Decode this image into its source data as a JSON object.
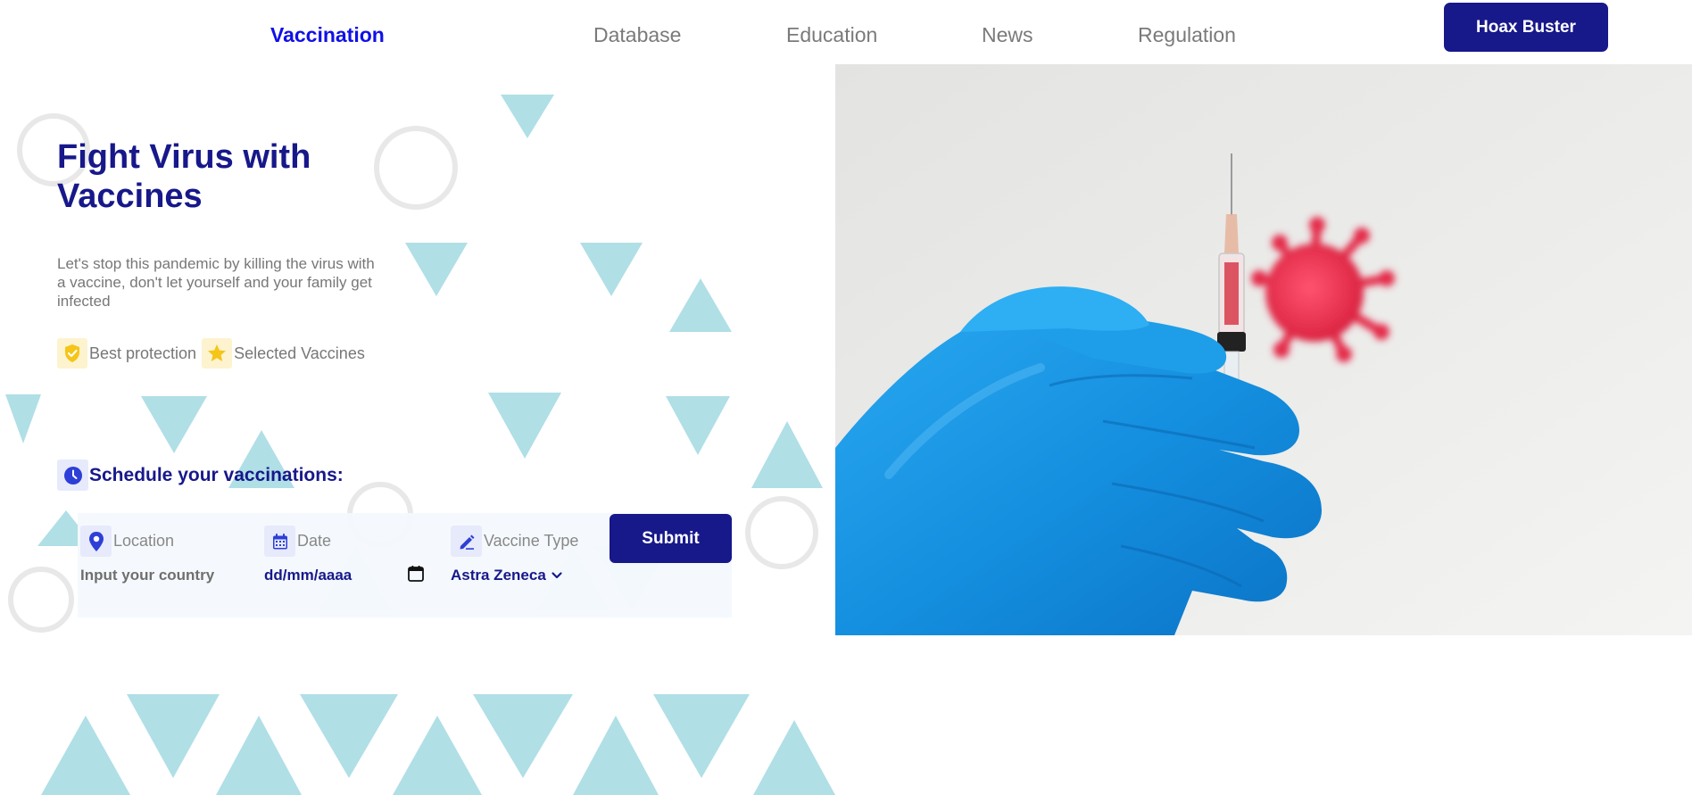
{
  "nav": {
    "brand": "Vaccination",
    "links": [
      "Database",
      "Education",
      "News",
      "Regulation"
    ],
    "cta": "Hoax Buster"
  },
  "hero": {
    "title": "Fight Virus with Vaccines",
    "description": "Let's stop this pandemic by killing the virus with a vaccine, don't let yourself and your family get infected",
    "features": [
      {
        "icon": "shield-check-icon",
        "label": "Best protection"
      },
      {
        "icon": "star-icon",
        "label": "Selected Vaccines"
      }
    ]
  },
  "schedule": {
    "icon": "clock-icon",
    "title": "Schedule your vaccinations:",
    "location": {
      "label": "Location",
      "placeholder": "Input your country",
      "icon": "location-pin-icon"
    },
    "date": {
      "label": "Date",
      "value": "dd/mm/aaaa",
      "icon": "calendar-icon"
    },
    "vaccine": {
      "label": "Vaccine Type",
      "selected": "Astra Zeneca",
      "icon": "pen-icon"
    },
    "submit": "Submit"
  },
  "colors": {
    "primary": "#17188a",
    "brand_link": "#1010e8",
    "muted_text": "#777777",
    "pattern": "#a8dce4",
    "glove": "#1a9ae8",
    "virus": "#e8304a",
    "feature_icon": "#f5c518"
  }
}
